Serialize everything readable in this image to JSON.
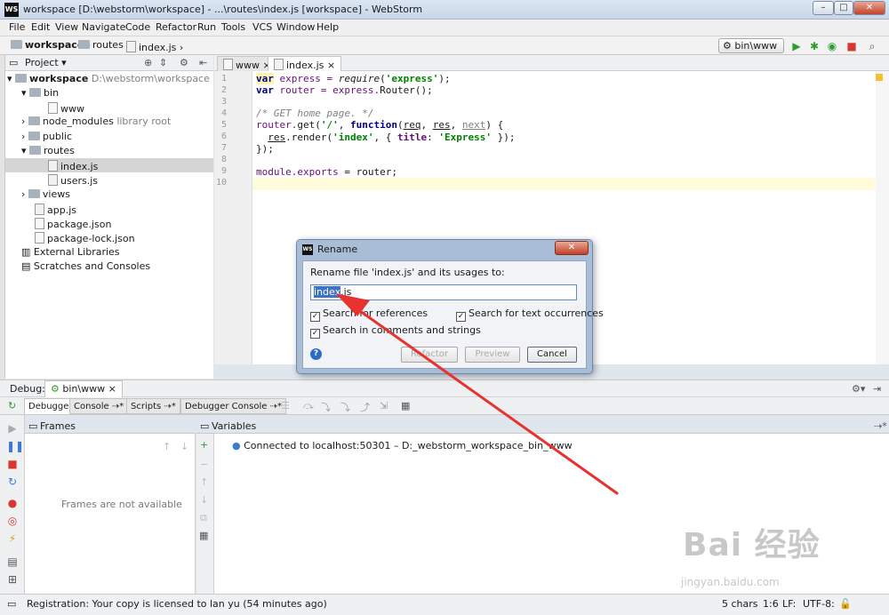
{
  "window": {
    "app_icon": "WS",
    "title": "workspace [D:\\webstorm\\workspace] - ...\\routes\\index.js [workspace] - WebStorm",
    "min": "–",
    "max": "□",
    "close": "✕"
  },
  "menu": [
    "File",
    "Edit",
    "View",
    "Navigate",
    "Code",
    "Refactor",
    "Run",
    "Tools",
    "VCS",
    "Window",
    "Help"
  ],
  "breadcrumb": [
    "workspace",
    "routes",
    "index.js"
  ],
  "run_config": "bin\\www",
  "project": {
    "header": "Project",
    "tree": [
      {
        "label": "workspace",
        "extra": "D:\\webstorm\\workspace",
        "bold": true
      },
      {
        "label": "bin"
      },
      {
        "label": "www"
      },
      {
        "label": "node_modules",
        "extra": "library root"
      },
      {
        "label": "public"
      },
      {
        "label": "routes"
      },
      {
        "label": "index.js"
      },
      {
        "label": "users.js"
      },
      {
        "label": "views"
      },
      {
        "label": "app.js"
      },
      {
        "label": "package.json"
      },
      {
        "label": "package-lock.json"
      },
      {
        "label": "External Libraries"
      },
      {
        "label": "Scratches and Consoles"
      }
    ]
  },
  "tabs": [
    {
      "label": "www"
    },
    {
      "label": "index.js"
    }
  ],
  "code": {
    "line_numbers": [
      "1",
      "2",
      "3",
      "4",
      "5",
      "6",
      "7",
      "8",
      "9",
      "10"
    ],
    "l1": {
      "kw": "var",
      "name": " express = ",
      "call": "require",
      "open": "(",
      "str": "'express'",
      "close": ");"
    },
    "l2": {
      "kw": "var",
      "name": " router = express.",
      "call": "Router",
      "close": "();"
    },
    "l4": "/* GET home page. */",
    "l5": {
      "a": "router.",
      "b": "get",
      "c": "(",
      "s": "'/'",
      "d": ", ",
      "kw": "function",
      "e": "(",
      "p1": "req",
      "f": ", ",
      "p2": "res",
      "g": ", ",
      "p3": "next",
      "h": ") {"
    },
    "l6": {
      "a": "  ",
      "res": "res",
      "b": ".",
      "c": "render",
      "d": "(",
      "s1": "'index'",
      "e": ", { ",
      "k": "title",
      "f": ": ",
      "s2": "'Express'",
      "g": " });"
    },
    "l7": "});",
    "l9": {
      "a": "module.",
      "b": "exports",
      "c": " = router;"
    }
  },
  "dialog": {
    "app_icon": "WS",
    "title": "Rename",
    "close": "✕",
    "prompt": "Rename file 'index.js' and its usages to:",
    "input_selected": "index",
    "input_rest": ".js",
    "check_refs": "Search for references",
    "check_text": "Search for text occurrences",
    "check_comments": "Search in comments and strings",
    "check_mark": "✓",
    "help": "?",
    "btn_refactor": "Refactor",
    "btn_preview": "Preview",
    "btn_cancel": "Cancel"
  },
  "debug": {
    "label": "Debug:",
    "session": "bin\\www",
    "tabs": [
      "Debugger",
      "Console",
      "Scripts",
      "Debugger Console"
    ],
    "frames_header": "Frames",
    "frames_empty": "Frames are not available",
    "variables_header": "Variables",
    "connected": "Connected to localhost:50301 – D:_webstorm_workspace_bin_www"
  },
  "status": {
    "message": "Registration: Your copy is licensed to lan yu (54 minutes ago)",
    "chars": "5 chars",
    "position": "1:6",
    "line_sep": "LF:",
    "encoding": "UTF-8:"
  },
  "watermark": {
    "brand": "Bai 经验",
    "url": "jingyan.baidu.com"
  },
  "colors": {
    "accent_arrow": "#e8322f",
    "selection": "#3d73c7",
    "current_line": "#fffbdb"
  }
}
